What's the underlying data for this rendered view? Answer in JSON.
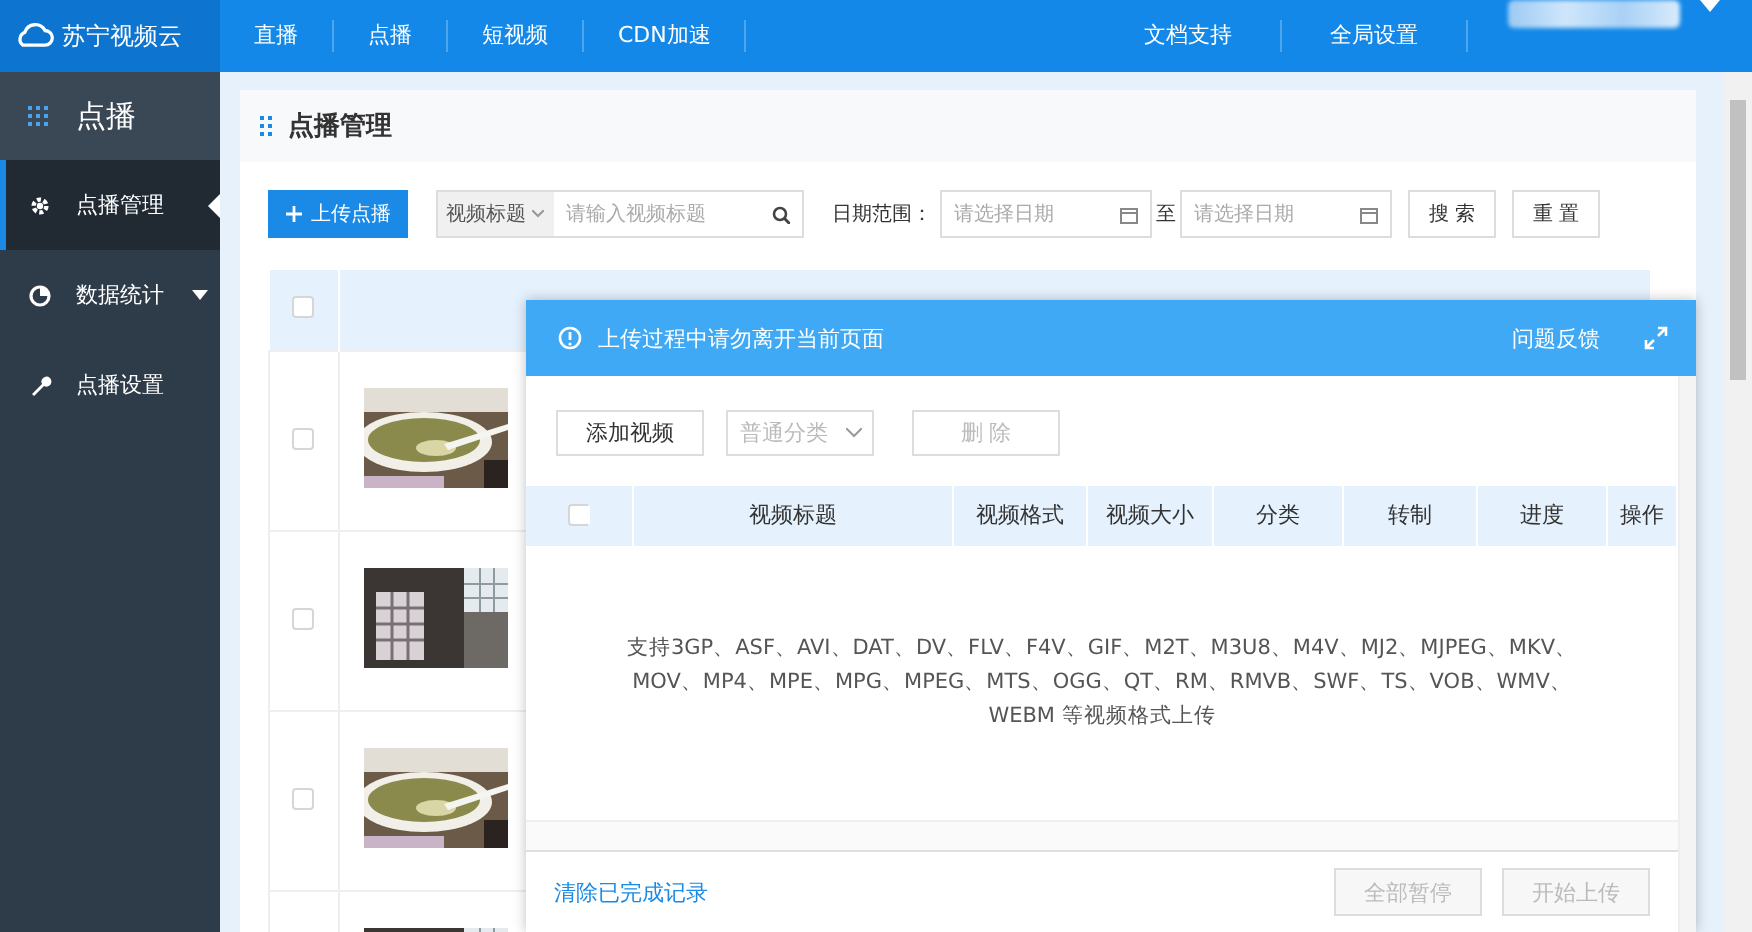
{
  "topbar": {
    "logo": "苏宁视频云",
    "nav": [
      {
        "label": "直播",
        "selected": false
      },
      {
        "label": "点播",
        "selected": false
      },
      {
        "label": "短视频",
        "selected": false
      },
      {
        "label": "CDN加速",
        "selected": false
      }
    ],
    "right_links": [
      "文档支持",
      "全局设置"
    ]
  },
  "sidebar": {
    "header": "点播",
    "items": [
      {
        "label": "点播管理",
        "selected": true,
        "has_caret": false
      },
      {
        "label": "数据统计",
        "selected": false,
        "has_caret": true
      },
      {
        "label": "点播设置",
        "selected": false,
        "has_caret": false
      }
    ]
  },
  "page": {
    "title": "点播管理",
    "upload_button": "上传点播",
    "search": {
      "field": "视频标题",
      "placeholder": "请输入视频标题"
    },
    "date_label": "日期范围：",
    "date_from": {
      "placeholder": "请选择日期"
    },
    "date_sep": "至",
    "date_to": {
      "placeholder": "请选择日期"
    },
    "buttons": [
      "搜 索",
      "重 置"
    ],
    "table": {
      "select_all": {
        "checked": false
      },
      "rows": [
        {
          "kind": "video",
          "checked": false
        },
        {
          "kind": "video",
          "checked": false
        },
        {
          "kind": "video",
          "checked": false
        },
        {
          "kind": "video"
        }
      ]
    }
  },
  "dialog": {
    "notice": "上传过程中请勿离开当前页面",
    "feedback": "问题反馈",
    "add_button": "添加视频",
    "category": {
      "value": "普通分类",
      "disabled": true
    },
    "delete_button": {
      "label": "删 除",
      "disabled": true
    },
    "select_all": {
      "checked": false
    },
    "columns": [
      "视频标题",
      "视频格式",
      "视频大小",
      "分类",
      "转制",
      "进度",
      "操作"
    ],
    "empty_text": "支持3GP、ASF、AVI、DAT、DV、FLV、F4V、GIF、M2T、M3U8、M4V、MJ2、MJPEG、MKV、MOV、MP4、MPE、MPG、MPEG、MTS、OGG、QT、RM、RMVB、SWF、TS、VOB、WMV、WEBM 等视频格式上传",
    "clear_link": "清除已完成记录",
    "footer_buttons": [
      {
        "label": "全部暂停",
        "disabled": true
      },
      {
        "label": "开始上传",
        "disabled": true
      }
    ]
  }
}
